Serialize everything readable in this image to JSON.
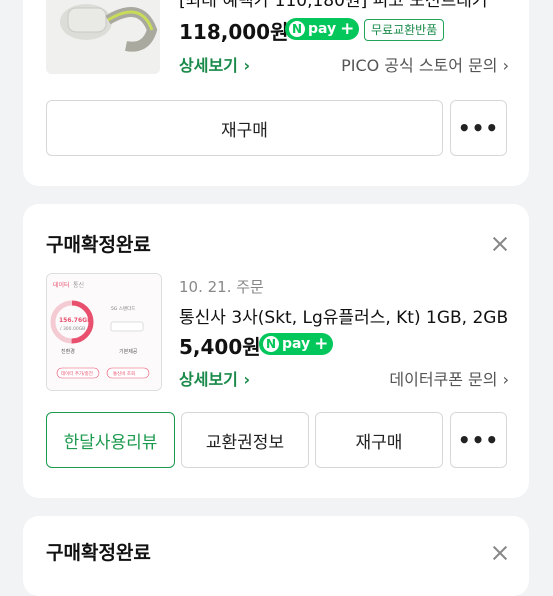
{
  "card1": {
    "title": "[최대 혜택가 110,180원] 피코 모션트래커",
    "price": "118,000원",
    "npay": {
      "n": "N",
      "pay": "pay",
      "plus": "+"
    },
    "tag": "무료교환반품",
    "detail_link": "상세보기",
    "store_link": "PICO 공식 스토어 문의",
    "rebuy": "재구매",
    "more": "•••"
  },
  "card2": {
    "heading": "구매확정완료",
    "date": "10. 21. 주문",
    "title": "통신사 3사(Skt, Lg유플러스, Kt) 1GB, 2GB",
    "price": "5,400원",
    "npay": {
      "n": "N",
      "pay": "pay",
      "plus": "+"
    },
    "detail_link": "상세보기",
    "store_link": "데이터쿠폰 문의",
    "review": "한달사용리뷰",
    "voucher": "교환권정보",
    "rebuy": "재구매",
    "more": "•••",
    "thumb": {
      "tab1": "데이터",
      "tab2": "통신",
      "gauge_value": "156.76GB",
      "gauge_total": "/ 300.00GB",
      "badge": "5G 스탠다드",
      "btn1": "친환경",
      "btn2": "기본제공",
      "footer1": "데이터 추가/충전",
      "footer2": "통신비 조회"
    }
  },
  "card3": {
    "heading": "구매확정완료"
  },
  "colors": {
    "accent": "#1c9a4e",
    "npay": "#03c75a",
    "gauge": "#e8506e"
  }
}
